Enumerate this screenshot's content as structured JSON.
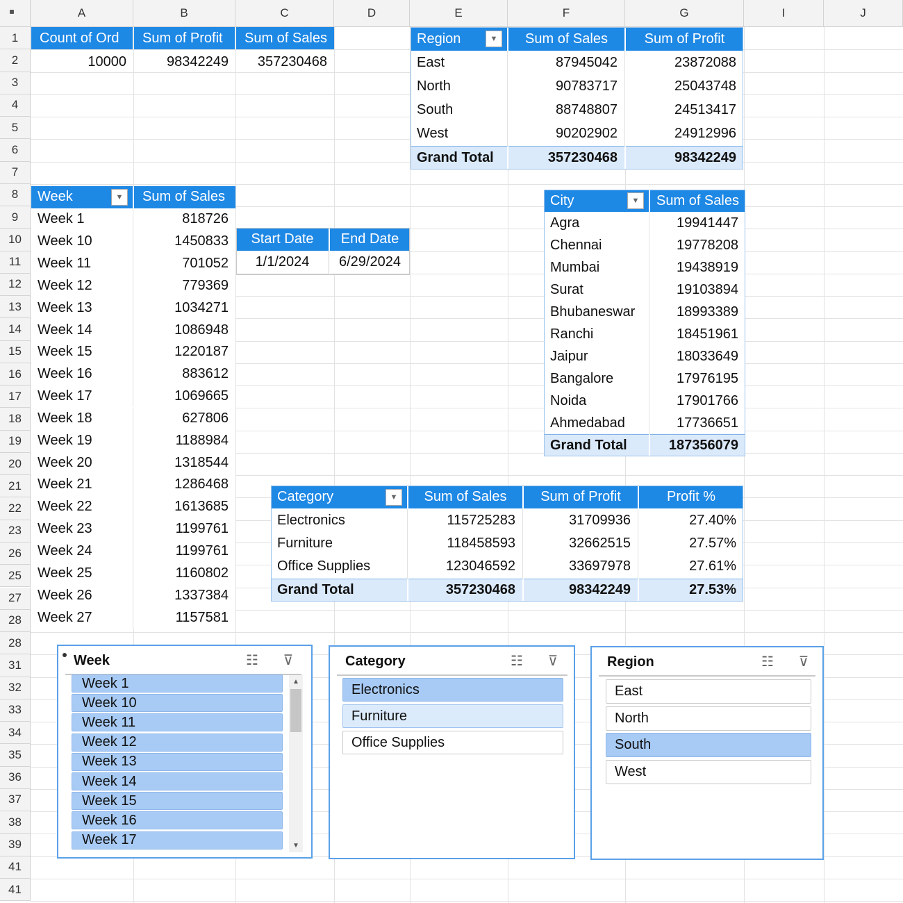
{
  "columns": [
    "A",
    "B",
    "C",
    "D",
    "E",
    "F",
    "G",
    "I",
    "J"
  ],
  "rows": [
    "1",
    "2",
    "3",
    "4",
    "5",
    "6",
    "7",
    "8",
    "9",
    "10",
    "11",
    "12",
    "13",
    "14",
    "15",
    "16",
    "17",
    "18",
    "19",
    "20",
    "21",
    "22",
    "23",
    "26",
    "25",
    "27",
    "28",
    "28",
    "31",
    "32",
    "33",
    "34",
    "35",
    "36",
    "37",
    "38",
    "39",
    "41",
    "41"
  ],
  "summary": {
    "headers": [
      "Count of Ord",
      "Sum of Profit",
      "Sum of Sales"
    ],
    "values": [
      "10000",
      "98342249",
      "357230468"
    ]
  },
  "region_pivot": {
    "headers": [
      "Region",
      "Sum of Sales",
      "Sum of Profit"
    ],
    "rows": [
      [
        "East",
        "87945042",
        "23872088"
      ],
      [
        "North",
        "90783717",
        "25043748"
      ],
      [
        "South",
        "88748807",
        "24513417"
      ],
      [
        "West",
        "90202902",
        "24912996"
      ]
    ],
    "total": [
      "Grand Total",
      "357230468",
      "98342249"
    ]
  },
  "week_pivot": {
    "headers": [
      "Week",
      "Sum of Sales"
    ],
    "rows": [
      [
        "Week 1",
        "818726"
      ],
      [
        "Week 10",
        "1450833"
      ],
      [
        "Week 11",
        "701052"
      ],
      [
        "Week 12",
        "779369"
      ],
      [
        "Week 13",
        "1034271"
      ],
      [
        "Week 14",
        "1086948"
      ],
      [
        "Week 15",
        "1220187"
      ],
      [
        "Week 16",
        "883612"
      ],
      [
        "Week 17",
        "1069665"
      ],
      [
        "Week 18",
        "627806"
      ],
      [
        "Week 19",
        "1188984"
      ],
      [
        "Week 20",
        "1318544"
      ],
      [
        "Week 21",
        "1286468"
      ],
      [
        "Week 22",
        "1613685"
      ],
      [
        "Week 23",
        "1199761"
      ],
      [
        "Week 24",
        "1199761"
      ],
      [
        "Week 25",
        "1160802"
      ],
      [
        "Week 26",
        "1337384"
      ],
      [
        "Week 27",
        "1157581"
      ]
    ]
  },
  "dates": {
    "headers": [
      "Start Date",
      "End Date"
    ],
    "values": [
      "1/1/2024",
      "6/29/2024"
    ]
  },
  "city_pivot": {
    "headers": [
      "City",
      "Sum of Sales"
    ],
    "rows": [
      [
        "Agra",
        "19941447"
      ],
      [
        "Chennai",
        "19778208"
      ],
      [
        "Mumbai",
        "19438919"
      ],
      [
        "Surat",
        "19103894"
      ],
      [
        "Bhubaneswar",
        "18993389"
      ],
      [
        "Ranchi",
        "18451961"
      ],
      [
        "Jaipur",
        "18033649"
      ],
      [
        "Bangalore",
        "17976195"
      ],
      [
        "Noida",
        "17901766"
      ],
      [
        "Ahmedabad",
        "17736651"
      ]
    ],
    "total": [
      "Grand Total",
      "187356079"
    ]
  },
  "category_pivot": {
    "headers": [
      "Category",
      "Sum of Sales",
      "Sum of Profit",
      "Profit %"
    ],
    "rows": [
      [
        "Electronics",
        "115725283",
        "31709936",
        "27.40%"
      ],
      [
        "Furniture",
        "118458593",
        "32662515",
        "27.57%"
      ],
      [
        "Office Supplies",
        "123046592",
        "33697978",
        "27.61%"
      ]
    ],
    "total": [
      "Grand Total",
      "357230468",
      "98342249",
      "27.53%"
    ]
  },
  "slicers": {
    "week": {
      "title": "Week",
      "items": [
        "Week 1",
        "Week 10",
        "Week 11",
        "Week 12",
        "Week 13",
        "Week 14",
        "Week 15",
        "Week 16",
        "Week 17"
      ]
    },
    "category": {
      "title": "Category",
      "items": [
        "Electronics",
        "Furniture",
        "Office Supplies"
      ]
    },
    "region": {
      "title": "Region",
      "items": [
        "East",
        "North",
        "South",
        "West"
      ]
    }
  },
  "colors": {
    "header_blue": "#1e88e5",
    "total_bg": "#dbeafb",
    "slicer_selected": "#a8cbf5"
  }
}
